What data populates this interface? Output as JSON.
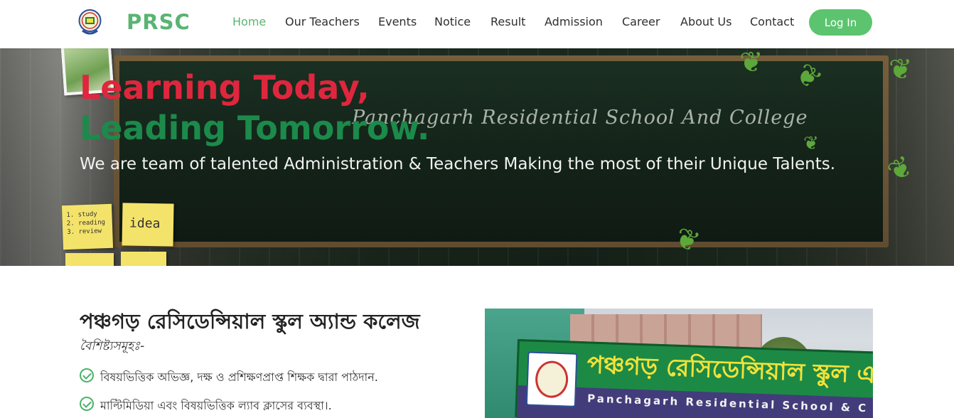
{
  "header": {
    "brand": "PRSC",
    "nav": [
      {
        "label": "Home",
        "active": true
      },
      {
        "label": "Our Teachers",
        "active": false
      },
      {
        "label": "Events",
        "active": false
      },
      {
        "label": "Notice",
        "active": false
      },
      {
        "label": "Result",
        "active": false
      },
      {
        "label": "Admission",
        "active": false
      },
      {
        "label": "Career",
        "active": false
      },
      {
        "label": "About Us",
        "active": false
      },
      {
        "label": "Contact",
        "active": false
      }
    ],
    "login_label": "Log In"
  },
  "hero": {
    "line1": "Learning Today,",
    "line2": "Leading Tomorrow.",
    "board_text": "Panchagarh Residential School And College",
    "subtitle": "We are team of talented Administration & Teachers Making the most of their Unique Talents.",
    "note1": "1. study\n2. reading\n3. review",
    "note2": "idea"
  },
  "content": {
    "title": "পঞ্চগড় রেসিডেন্সিয়াল স্কুল অ্যান্ড কলেজ",
    "subtitle": "বৈশিষ্ট্যসমূহঃ-",
    "features": [
      "বিষয়ভিত্তিক অভিজ্ঞ, দক্ষ ও প্রশিক্ষণপ্রাপ্ত শিক্ষক দ্বারা পাঠদান.",
      "মাল্টিমিডিয়া এবং বিষয়ভিত্তিক ল্যাব ক্লাসের ব্যবস্থা।."
    ]
  },
  "photo_sign": {
    "bengali": "পঞ্চগড় রেসিডেন্সিয়াল স্কুল এন্ড ক",
    "english": "Panchagarh Residential School & C"
  },
  "colors": {
    "brand_green": "#5ab473",
    "hero_red": "#e0263e",
    "hero_green": "#1c8a4b",
    "button_green": "#5cc46f"
  }
}
